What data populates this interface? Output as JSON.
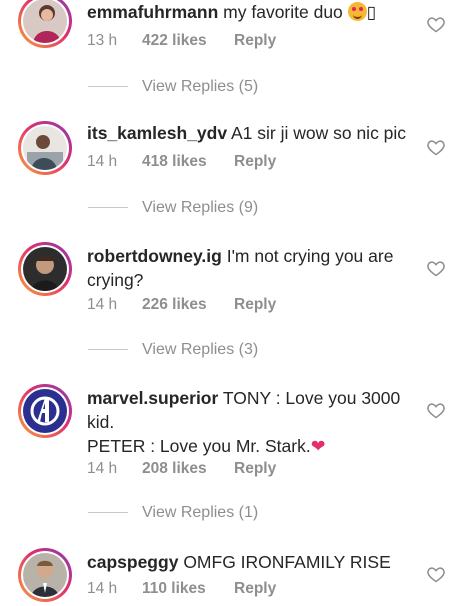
{
  "comments": [
    {
      "username": "emmafuhrmann",
      "text": "my favorite duo",
      "text_suffix": "😍",
      "trailing_glyph": "▯",
      "time": "13 h",
      "likes": "422 likes",
      "reply": "Reply",
      "view_replies": "View Replies (5)",
      "avatar": "woman-photo"
    },
    {
      "username": "its_kamlesh_ydv",
      "text": "A1 sir ji wow so nic pic",
      "time": "14 h",
      "likes": "418 likes",
      "reply": "Reply",
      "view_replies": "View Replies (9)",
      "avatar": "man-desk-photo"
    },
    {
      "username": "robertdowney.ig",
      "text": "I'm not crying you are crying?",
      "time": "14 h",
      "likes": "226 likes",
      "reply": "Reply",
      "view_replies": "View Replies (3)",
      "avatar": "man-portrait-photo"
    },
    {
      "username": "marvel.superior",
      "text": "TONY : Love you 3000 kid.",
      "text_line2": "PETER : Love you Mr. Stark.",
      "text_line2_suffix": "❤",
      "time": "14 h",
      "likes": "208 likes",
      "reply": "Reply",
      "view_replies": "View Replies (1)",
      "avatar": "avengers-logo"
    },
    {
      "username": "capspeggy",
      "text": "OMFG IRONFAMILY RISE",
      "time": "14 h",
      "likes": "110 likes",
      "reply": "Reply",
      "avatar": "man-suit-photo"
    }
  ],
  "icons": {
    "like": "heart-outline-icon"
  },
  "colors": {
    "secondary_text": "#8e8e8e",
    "story_ring_start": "#f9a33a",
    "story_ring_end": "#833ab4",
    "heart_emoji": "#e1306c"
  }
}
